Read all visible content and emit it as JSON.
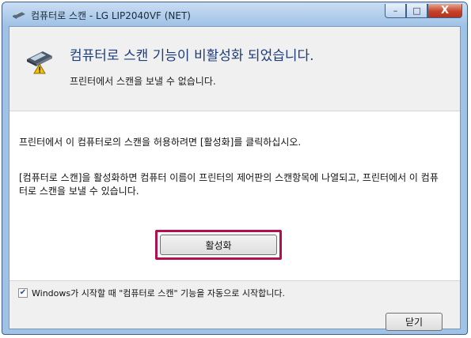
{
  "window": {
    "title": "컴퓨터로 스캔 - LG LIP2040VF (NET)",
    "controls": {
      "minimize": "–",
      "maximize": "□",
      "close": "X"
    }
  },
  "header": {
    "headline": "컴퓨터로 스캔 기능이 비활성화 되었습니다.",
    "subline": "프린터에서 스캔을 보낼 수 없습니다."
  },
  "panel": {
    "para1": "프린터에서 이 컴퓨터로의 스캔을 허용하려면 [활성화]를 클릭하십시오.",
    "para2": "[컴퓨터로 스캔]을 활성화하면 컴퓨터 이름이 프린터의 제어판의 스캔항목에 나열되고, 프린터에서 이 컴퓨터로 스캔을 보낼 수 있습니다.",
    "activate_label": "활성화"
  },
  "footer": {
    "checkbox_checked": true,
    "checkbox_label": "Windows가 시작할 때 \"컴퓨터로 스캔\" 기능을 자동으로 시작합니다.",
    "close_label": "닫기"
  },
  "icons": {
    "title": "scanner-icon",
    "header": "scanner-warning-icon"
  },
  "colors": {
    "highlight_border": "#b01050",
    "headline": "#1d3d7a"
  }
}
